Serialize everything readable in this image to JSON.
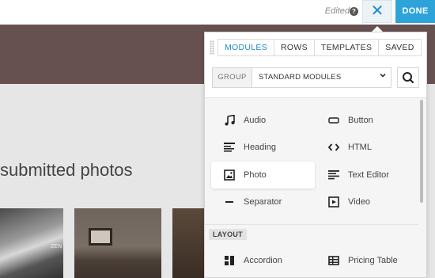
{
  "topbar": {
    "edited_label": "Edited",
    "help_glyph": "?",
    "close_glyph": "✕",
    "done_label": "DONE"
  },
  "page": {
    "heading": "submitted photos",
    "thumb_caption": "ZEN"
  },
  "panel": {
    "tabs": [
      {
        "label": "MODULES",
        "active": true
      },
      {
        "label": "ROWS",
        "active": false
      },
      {
        "label": "TEMPLATES",
        "active": false
      },
      {
        "label": "SAVED",
        "active": false
      }
    ],
    "group_label": "GROUP",
    "group_value": "STANDARD MODULES",
    "modules": [
      {
        "label": "Audio",
        "icon": "music-note-icon"
      },
      {
        "label": "Button",
        "icon": "button-icon"
      },
      {
        "label": "Heading",
        "icon": "heading-icon"
      },
      {
        "label": "HTML",
        "icon": "code-icon"
      },
      {
        "label": "Photo",
        "icon": "photo-icon",
        "selected": true
      },
      {
        "label": "Text Editor",
        "icon": "text-editor-icon"
      },
      {
        "label": "Separator",
        "icon": "separator-icon"
      },
      {
        "label": "Video",
        "icon": "video-icon"
      }
    ],
    "layout_section": "LAYOUT",
    "layout_modules": [
      {
        "label": "Accordion",
        "icon": "accordion-icon"
      },
      {
        "label": "Pricing Table",
        "icon": "pricing-table-icon"
      }
    ]
  },
  "colors": {
    "accent": "#2ea3d9",
    "hero": "#675150"
  }
}
